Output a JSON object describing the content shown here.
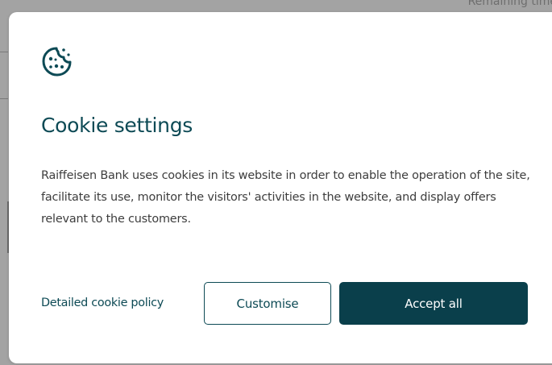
{
  "background": {
    "partial_text": "Remaining time"
  },
  "dialog": {
    "icon": "cookie-icon",
    "title": "Cookie settings",
    "description": "Raiffeisen Bank uses cookies in its website in order to enable the operation of the site, facilitate its use, monitor the visitors' activities in the website, and display offers relevant to the customers.",
    "policy_link": "Detailed cookie policy",
    "customise_label": "Customise",
    "accept_label": "Accept all"
  },
  "colors": {
    "brand": "#0a3f4b",
    "title": "#0d4a55",
    "text": "#3d3d3d",
    "overlay": "#a3a3a3"
  }
}
